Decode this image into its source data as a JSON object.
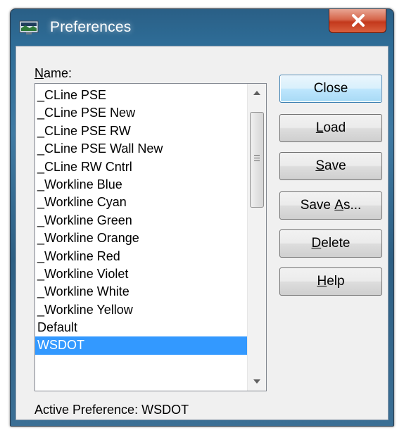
{
  "window": {
    "title": "Preferences"
  },
  "name_label": {
    "pre": "",
    "accel": "N",
    "post": "ame:"
  },
  "list": {
    "items": [
      "_CLine PSE",
      "_CLine PSE New",
      "_CLine PSE RW",
      "_CLine PSE Wall New",
      "_CLine RW Cntrl",
      "_Workline Blue",
      "_Workline Cyan",
      "_Workline Green",
      "_Workline Orange",
      "_Workline Red",
      "_Workline Violet",
      "_Workline White",
      "_Workline Yellow",
      "Default",
      "WSDOT"
    ],
    "selected": "WSDOT"
  },
  "buttons": {
    "close": {
      "pre": "Close",
      "accel": "",
      "post": ""
    },
    "load": {
      "pre": "",
      "accel": "L",
      "post": "oad"
    },
    "save": {
      "pre": "",
      "accel": "S",
      "post": "ave"
    },
    "save_as": {
      "pre": "Save ",
      "accel": "A",
      "post": "s..."
    },
    "delete": {
      "pre": "",
      "accel": "D",
      "post": "elete"
    },
    "help": {
      "pre": "",
      "accel": "H",
      "post": "elp"
    }
  },
  "active_preference": {
    "label": "Active Preference:",
    "value": "WSDOT"
  },
  "colors": {
    "selection": "#3399ff",
    "close_button": "#c3381c",
    "titlebar": "#2e6c96"
  },
  "icons": {
    "app": "preferences-app-icon",
    "close": "close-icon",
    "scroll_up": "chevron-up-icon",
    "scroll_down": "chevron-down-icon"
  }
}
